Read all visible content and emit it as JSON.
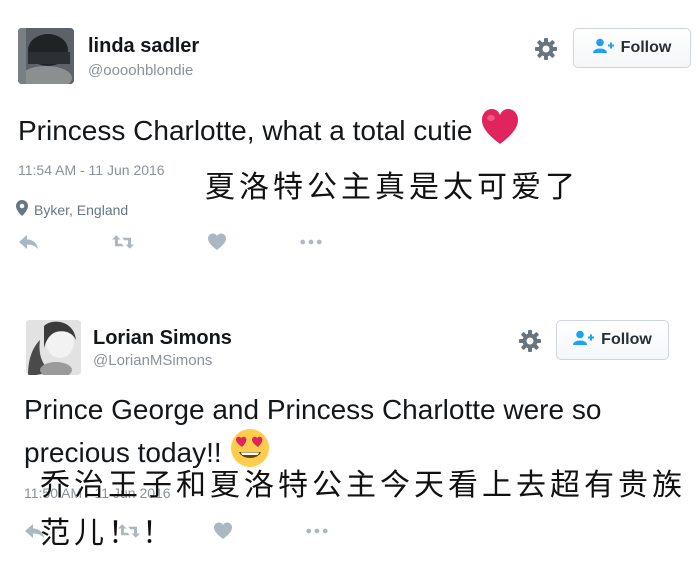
{
  "tweets": [
    {
      "display_name": "linda sadler",
      "handle": "@oooohblondie",
      "follow_label": "Follow",
      "text": "Princess Charlotte, what a total cutie",
      "emoji": "heart",
      "timestamp": "11:54 AM - 11 Jun 2016",
      "location": "Byker, England",
      "caption": "夏洛特公主真是太可爱了"
    },
    {
      "display_name": "Lorian Simons",
      "handle": "@LorianMSimons",
      "follow_label": "Follow",
      "text": "Prince George and Princess Charlotte were so precious today!!",
      "emoji": "heart-eyes",
      "timestamp": "11:50 AM - 11 Jun 2016",
      "caption": "乔治王子和夏洛特公主今天看上去超有贵族范儿！！"
    }
  ],
  "colors": {
    "text": "#14171a",
    "muted": "#8a9299",
    "icon": "#aab8c2",
    "follow_icon": "#1da1f2",
    "heart": "#e0245e",
    "emoji_yellow": "#ffcc4d"
  },
  "icons": [
    "gear-icon",
    "follow-user-icon",
    "location-pin-icon",
    "reply-icon",
    "retweet-icon",
    "like-icon",
    "more-icon"
  ]
}
